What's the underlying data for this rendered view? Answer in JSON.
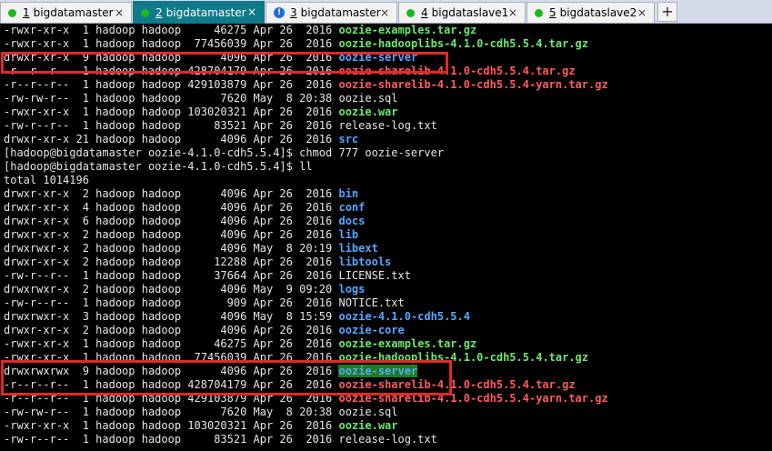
{
  "tabs": [
    {
      "num": "1",
      "label": "bigdatamaster",
      "status": "connected",
      "active": false
    },
    {
      "num": "2",
      "label": "bigdatamaster",
      "status": "connected",
      "active": true
    },
    {
      "num": "3",
      "label": "bigdatamaster",
      "status": "warning",
      "active": false
    },
    {
      "num": "4",
      "label": "bigdataslave1",
      "status": "connected",
      "active": false
    },
    {
      "num": "5",
      "label": "bigdataslave2",
      "status": "connected",
      "active": false
    }
  ],
  "tab_close_glyph": "×",
  "add_tab_glyph": "+",
  "colors": {
    "dir": "#55a8ff",
    "exec": "#6de86d",
    "archive": "#ff5c5c",
    "highlight_bg": "#1e7d1e",
    "annotation_box": "#e0292b",
    "active_tab": "#0f7a8c"
  },
  "lines": [
    {
      "prefix": "-rwxr-xr-x  1 hadoop hadoop     46275 Apr 26  2016 ",
      "name": "oozie-examples.tar.gz",
      "color": "green"
    },
    {
      "prefix": "-rwxr-xr-x  1 hadoop hadoop  77456039 Apr 26  2016 ",
      "name": "oozie-hadooplibs-4.1.0-cdh5.5.4.tar.gz",
      "color": "green"
    },
    {
      "prefix": "drwxr-xr-x  9 hadoop hadoop      4096 Apr 26  2016 ",
      "name": "oozie-server",
      "color": "blue"
    },
    {
      "prefix": "-r--r--r--  1 hadoop hadoop 428704179 Apr 26  2016 ",
      "name": "oozie-sharelib-4.1.0-cdh5.5.4.tar.gz",
      "color": "red"
    },
    {
      "prefix": "-r--r--r--  1 hadoop hadoop 429103879 Apr 26  2016 ",
      "name": "oozie-sharelib-4.1.0-cdh5.5.4-yarn.tar.gz",
      "color": "red"
    },
    {
      "prefix": "-rw-rw-r--  1 hadoop hadoop      7620 May  8 20:38 ",
      "name": "oozie.sql",
      "color": "plain"
    },
    {
      "prefix": "-rwxr-xr-x  1 hadoop hadoop 103020321 Apr 26  2016 ",
      "name": "oozie.war",
      "color": "green"
    },
    {
      "prefix": "-rw-r--r--  1 hadoop hadoop     83521 Apr 26  2016 ",
      "name": "release-log.txt",
      "color": "plain"
    },
    {
      "prefix": "drwxr-xr-x 21 hadoop hadoop      4096 Apr 26  2016 ",
      "name": "src",
      "color": "blue"
    },
    {
      "prefix": "[hadoop@bigdatamaster oozie-4.1.0-cdh5.5.4]$ chmod 777 oozie-server",
      "name": "",
      "color": "plain"
    },
    {
      "prefix": "[hadoop@bigdatamaster oozie-4.1.0-cdh5.5.4]$ ll",
      "name": "",
      "color": "plain"
    },
    {
      "prefix": "total 1014196",
      "name": "",
      "color": "plain"
    },
    {
      "prefix": "drwxr-xr-x  2 hadoop hadoop      4096 Apr 26  2016 ",
      "name": "bin",
      "color": "blue"
    },
    {
      "prefix": "drwxr-xr-x  4 hadoop hadoop      4096 Apr 26  2016 ",
      "name": "conf",
      "color": "blue"
    },
    {
      "prefix": "drwxr-xr-x  6 hadoop hadoop      4096 Apr 26  2016 ",
      "name": "docs",
      "color": "blue"
    },
    {
      "prefix": "drwxr-xr-x  2 hadoop hadoop      4096 Apr 26  2016 ",
      "name": "lib",
      "color": "blue"
    },
    {
      "prefix": "drwxrwxr-x  2 hadoop hadoop      4096 May  8 20:19 ",
      "name": "libext",
      "color": "blue"
    },
    {
      "prefix": "drwxr-xr-x  2 hadoop hadoop     12288 Apr 26  2016 ",
      "name": "libtools",
      "color": "blue"
    },
    {
      "prefix": "-rw-r--r--  1 hadoop hadoop     37664 Apr 26  2016 ",
      "name": "LICENSE.txt",
      "color": "plain"
    },
    {
      "prefix": "drwxrwxr-x  2 hadoop hadoop      4096 May  9 09:20 ",
      "name": "logs",
      "color": "blue"
    },
    {
      "prefix": "-rw-r--r--  1 hadoop hadoop       909 Apr 26  2016 ",
      "name": "NOTICE.txt",
      "color": "plain"
    },
    {
      "prefix": "drwxrwxr-x  3 hadoop hadoop      4096 May  8 15:59 ",
      "name": "oozie-4.1.0-cdh5.5.4",
      "color": "blue"
    },
    {
      "prefix": "drwxr-xr-x  2 hadoop hadoop      4096 Apr 26  2016 ",
      "name": "oozie-core",
      "color": "blue"
    },
    {
      "prefix": "-rwxr-xr-x  1 hadoop hadoop     46275 Apr 26  2016 ",
      "name": "oozie-examples.tar.gz",
      "color": "green"
    },
    {
      "prefix": "-rwxr-xr-x  1 hadoop hadoop  77456039 Apr 26  2016 ",
      "name": "oozie-hadooplibs-4.1.0-cdh5.5.4.tar.gz",
      "color": "green"
    },
    {
      "prefix": "drwxrwxrwx  9 hadoop hadoop      4096 Apr 26  2016 ",
      "name": "oozie-server",
      "color": "hl"
    },
    {
      "prefix": "-r--r--r--  1 hadoop hadoop 428704179 Apr 26  2016 ",
      "name": "oozie-sharelib-4.1.0-cdh5.5.4.tar.gz",
      "color": "red"
    },
    {
      "prefix": "-r--r--r--  1 hadoop hadoop 429103879 Apr 26  2016 ",
      "name": "oozie-sharelib-4.1.0-cdh5.5.4-yarn.tar.gz",
      "color": "red"
    },
    {
      "prefix": "-rw-rw-r--  1 hadoop hadoop      7620 May  8 20:38 ",
      "name": "oozie.sql",
      "color": "plain"
    },
    {
      "prefix": "-rwxr-xr-x  1 hadoop hadoop 103020321 Apr 26  2016 ",
      "name": "oozie.war",
      "color": "green"
    },
    {
      "prefix": "-rw-r--r--  1 hadoop hadoop     83521 Apr 26  2016 ",
      "name": "release-log.txt",
      "color": "plain"
    }
  ]
}
